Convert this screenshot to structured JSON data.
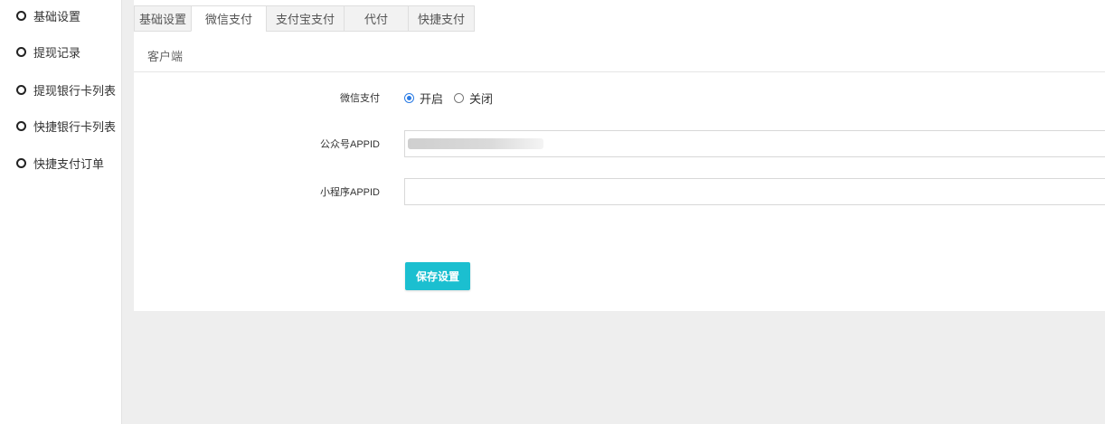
{
  "sidebar": {
    "items": [
      {
        "label": "基础设置"
      },
      {
        "label": "提现记录"
      },
      {
        "label": "提现银行卡列表"
      },
      {
        "label": "快捷银行卡列表"
      },
      {
        "label": "快捷支付订单"
      }
    ]
  },
  "tabs": [
    {
      "label": "基础设置",
      "active": false
    },
    {
      "label": "微信支付",
      "active": true
    },
    {
      "label": "支付宝支付",
      "active": false
    },
    {
      "label": "代付",
      "active": false
    },
    {
      "label": "快捷支付",
      "active": false
    }
  ],
  "subtab": {
    "label": "客户端"
  },
  "form": {
    "wechat_pay": {
      "label": "微信支付",
      "options": [
        {
          "label": "开启",
          "selected": true
        },
        {
          "label": "关闭",
          "selected": false
        }
      ]
    },
    "mp_appid": {
      "label": "公众号APPID",
      "value": ""
    },
    "mini_appid": {
      "label": "小程序APPID",
      "value": ""
    },
    "save_label": "保存设置"
  },
  "colors": {
    "accent": "#1bbfd0",
    "radio_selected": "#2a7be4",
    "background": "#eeeeee"
  }
}
